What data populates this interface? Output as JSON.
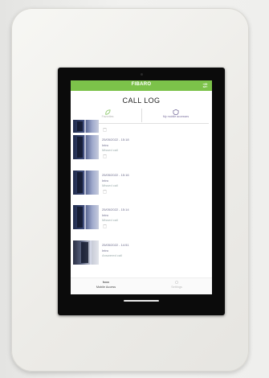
{
  "app": {
    "brand": "FIBARO",
    "title": "CALL LOG",
    "accent_color": "#7cc24a"
  },
  "tabs": [
    {
      "label": "Favorites",
      "icon": "leaf-icon",
      "active": false
    },
    {
      "label": "My mobile accesses",
      "icon": "shield-icon",
      "active": true
    }
  ],
  "calls": [
    {
      "date": "",
      "name": "",
      "status": ""
    },
    {
      "date": "25/05/2022 - 15:18",
      "name": "Intro",
      "status": "Missed call"
    },
    {
      "date": "25/05/2022 - 15:16",
      "name": "Intro",
      "status": "Missed call"
    },
    {
      "date": "25/05/2022 - 15:14",
      "name": "Intro",
      "status": "Missed call"
    },
    {
      "date": "25/05/2022 - 14:51",
      "name": "Intro",
      "status": "Answered call"
    }
  ],
  "bottom_nav": [
    {
      "label": "Mobile Access",
      "icon": "key-icon"
    },
    {
      "label": "Settings",
      "icon": "gear-icon"
    }
  ]
}
